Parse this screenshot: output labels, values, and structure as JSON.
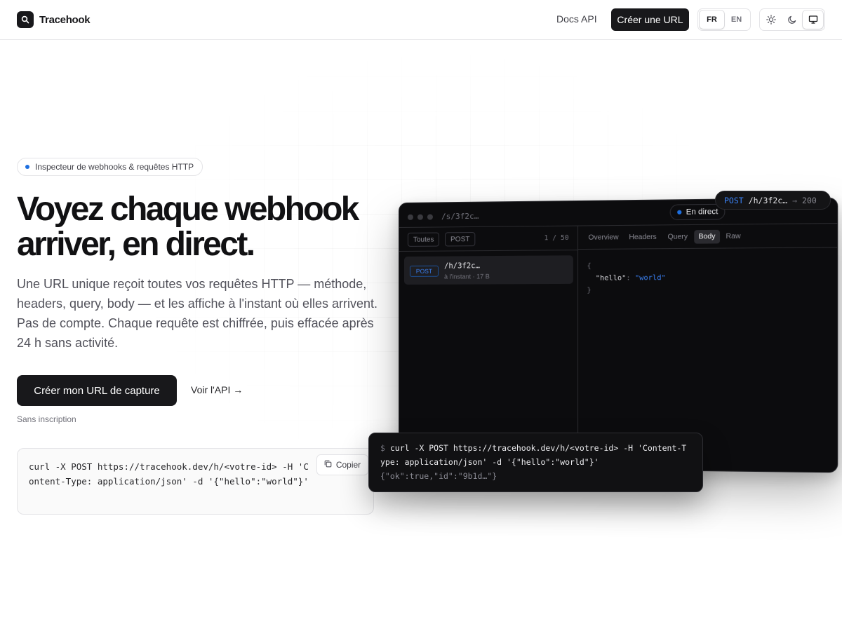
{
  "header": {
    "brand": "Tracehook",
    "docs_link": "Docs API",
    "create_button": "Créer une URL",
    "languages": [
      "FR",
      "EN"
    ],
    "active_language": "FR",
    "theme_options": [
      "sun-icon",
      "moon-icon",
      "monitor-icon"
    ],
    "active_theme": "monitor-icon"
  },
  "hero": {
    "badge": "Inspecteur de webhooks & requêtes HTTP",
    "headline_line1": "Voyez chaque webhook",
    "headline_line2": "arriver, en direct.",
    "lead": "Une URL unique reçoit toutes vos requêtes HTTP — méthode, headers, query, body — et les affiche à l'instant où elles arrivent. Pas de compte. Chaque requête est chiffrée, puis effacée après 24 h sans activité.",
    "cta_primary": "Créer mon URL de capture",
    "cta_secondary": "Voir l'API →",
    "note": "Sans inscription",
    "code_snippet": "curl -X POST https://tracehook.dev/h/<votre-id> -H 'Content-Type: application/json' -d '{\"hello\":\"world\"}'",
    "copy_label": "Copier"
  },
  "mockup": {
    "path": "/s/3f2c…",
    "live_label": "En direct",
    "filters": [
      "Toutes",
      "POST"
    ],
    "count": "1 / 50",
    "request": {
      "method": "POST",
      "path": "/h/3f2c…",
      "meta": "à l'instant · 17 B"
    },
    "tabs": [
      "Overview",
      "Headers",
      "Query",
      "Body",
      "Raw"
    ],
    "active_tab": "Body",
    "json": {
      "open": "{",
      "key": "\"hello\"",
      "colon": ":",
      "value": "\"world\"",
      "close": "}"
    }
  },
  "status_pill": {
    "method": "POST",
    "path": "/h/3f2c…",
    "arrow": "→",
    "code": "200"
  },
  "terminal": {
    "prompt": "$",
    "command": "curl -X POST https://tracehook.dev/h/<votre-id> -H 'Content-Type: application/json' -d '{\"hello\":\"world\"}'",
    "output": "{\"ok\":true,\"id\":\"9b1d…\"}"
  },
  "colors": {
    "accent": "#1d6fe0",
    "dark": "#18181b",
    "mockup_bg": "#0c0c0e"
  }
}
